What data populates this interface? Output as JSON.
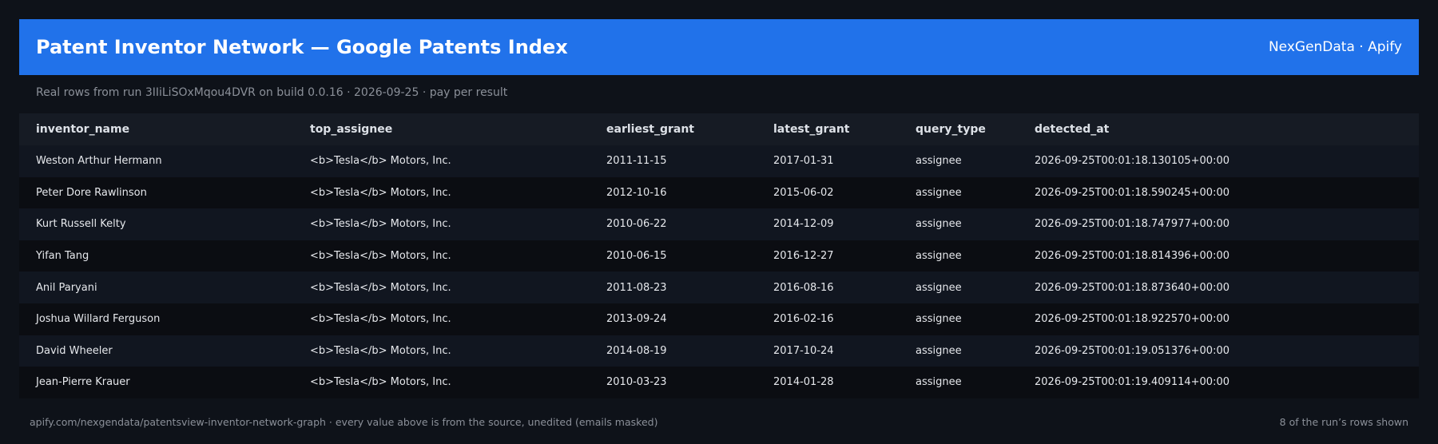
{
  "header": {
    "title": "Patent Inventor Network — Google Patents Index",
    "brand": "NexGenData · Apify"
  },
  "subtitle": "Real rows from run 3IIiLiSOxMqou4DVR on build 0.0.16 · 2026-09-25 · pay per result",
  "table": {
    "columns": [
      "inventor_name",
      "top_assignee",
      "earliest_grant",
      "latest_grant",
      "query_type",
      "detected_at"
    ],
    "rows": [
      [
        "Weston Arthur Hermann",
        "<b>Tesla</b> Motors, Inc.",
        "2011-11-15",
        "2017-01-31",
        "assignee",
        "2026-09-25T00:01:18.130105+00:00"
      ],
      [
        "Peter Dore Rawlinson",
        "<b>Tesla</b> Motors, Inc.",
        "2012-10-16",
        "2015-06-02",
        "assignee",
        "2026-09-25T00:01:18.590245+00:00"
      ],
      [
        "Kurt Russell Kelty",
        "<b>Tesla</b> Motors, Inc.",
        "2010-06-22",
        "2014-12-09",
        "assignee",
        "2026-09-25T00:01:18.747977+00:00"
      ],
      [
        "Yifan Tang",
        "<b>Tesla</b> Motors, Inc.",
        "2010-06-15",
        "2016-12-27",
        "assignee",
        "2026-09-25T00:01:18.814396+00:00"
      ],
      [
        "Anil Paryani",
        "<b>Tesla</b> Motors, Inc.",
        "2011-08-23",
        "2016-08-16",
        "assignee",
        "2026-09-25T00:01:18.873640+00:00"
      ],
      [
        "Joshua Willard Ferguson",
        "<b>Tesla</b> Motors, Inc.",
        "2013-09-24",
        "2016-02-16",
        "assignee",
        "2026-09-25T00:01:18.922570+00:00"
      ],
      [
        "David Wheeler",
        "<b>Tesla</b> Motors, Inc.",
        "2014-08-19",
        "2017-10-24",
        "assignee",
        "2026-09-25T00:01:19.051376+00:00"
      ],
      [
        "Jean-Pierre Krauer",
        "<b>Tesla</b> Motors, Inc.",
        "2010-03-23",
        "2014-01-28",
        "assignee",
        "2026-09-25T00:01:19.409114+00:00"
      ]
    ]
  },
  "footer": {
    "left": "apify.com/nexgendata/patentsview-inventor-network-graph  ·  every value above is from the source, unedited (emails masked)",
    "right": "8 of the run’s rows shown"
  },
  "colors": {
    "background": "#0e1219",
    "header": "#2172ea",
    "row_odd": "#111620",
    "row_even": "#0b0d12",
    "muted_text": "#8b9099"
  }
}
